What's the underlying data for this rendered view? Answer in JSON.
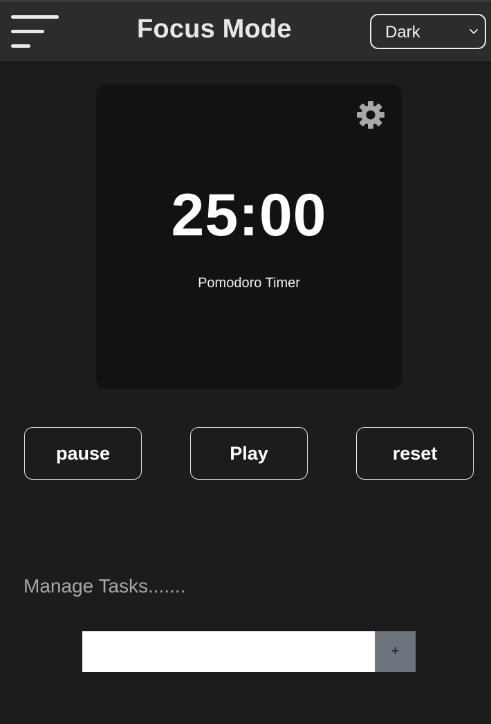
{
  "header": {
    "title": "Focus Mode",
    "menu_icon": "hamburger-menu-icon",
    "theme_select": {
      "selected": "Dark",
      "icon": "chevron-down-icon"
    }
  },
  "timer": {
    "time": "25:00",
    "label": "Pomodoro Timer",
    "settings_icon": "gear-icon"
  },
  "controls": {
    "pause_label": "pause",
    "play_label": "Play",
    "reset_label": "reset"
  },
  "tasks": {
    "heading": "Manage Tasks.......",
    "input_value": "",
    "add_label": "+"
  },
  "colors": {
    "background": "#1c1c1c",
    "header": "#2c2c2c",
    "card": "#121212",
    "add_button": "#6c757d"
  }
}
